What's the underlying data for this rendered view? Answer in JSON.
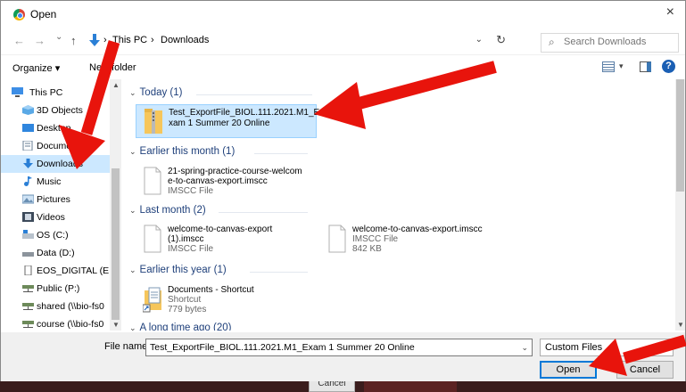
{
  "window": {
    "title": "Open",
    "close_glyph": "×"
  },
  "nav_buttons": {
    "back": "←",
    "forward": "→",
    "recent": "⌄",
    "up": "↑"
  },
  "address": {
    "crumbs": [
      "This PC",
      "Downloads"
    ],
    "separator": "›",
    "dropdown_glyph": "⌄",
    "refresh_glyph": "↻"
  },
  "search": {
    "placeholder": "Search Downloads",
    "icon": "search-icon"
  },
  "toolbar": {
    "organize": "Organize ▾",
    "new_folder": "New folder",
    "view_dropdown": "▾",
    "help": "?"
  },
  "nav_pane": {
    "items": [
      {
        "label": "This PC",
        "icon": "computer-icon"
      },
      {
        "label": "3D Objects",
        "icon": "cube-icon"
      },
      {
        "label": "Desktop",
        "icon": "desktop-icon"
      },
      {
        "label": "Documents",
        "icon": "document-icon"
      },
      {
        "label": "Downloads",
        "icon": "download-icon",
        "selected": true
      },
      {
        "label": "Music",
        "icon": "music-icon"
      },
      {
        "label": "Pictures",
        "icon": "pictures-icon"
      },
      {
        "label": "Videos",
        "icon": "video-icon"
      },
      {
        "label": "OS (C:)",
        "icon": "drive-icon"
      },
      {
        "label": "Data (D:)",
        "icon": "drive-icon"
      },
      {
        "label": "EOS_DIGITAL (E:)",
        "icon": "sd-card-icon"
      },
      {
        "label": "Public (P:)",
        "icon": "network-drive-icon"
      },
      {
        "label": "shared (\\\\bio-fs0",
        "icon": "network-drive-icon"
      },
      {
        "label": "course (\\\\bio-fs0",
        "icon": "network-drive-icon"
      }
    ]
  },
  "groups": [
    {
      "label": "Today (1)"
    },
    {
      "label": "Earlier this month (1)"
    },
    {
      "label": "Last month (2)"
    },
    {
      "label": "Earlier this year (1)"
    },
    {
      "label": "A long time ago (20)"
    }
  ],
  "files": {
    "today": {
      "name_line1": "Test_ExportFile_BIOL.111.2021.M1_E",
      "name_line2": "xam 1 Summer 20 Online",
      "icon": "zip-folder-icon"
    },
    "month": {
      "name_line1": "21-spring-practice-course-welcom",
      "name_line2": "e-to-canvas-export.imscc",
      "type": "IMSCC File"
    },
    "last1": {
      "name_line1": "welcome-to-canvas-export",
      "name_line2": "(1).imscc",
      "type": "IMSCC File"
    },
    "last2": {
      "name_line1": "welcome-to-canvas-export.imscc",
      "type": "IMSCC File",
      "size": "842 KB"
    },
    "year": {
      "name_line1": "Documents - Shortcut",
      "type": "Shortcut",
      "size": "779 bytes"
    }
  },
  "bottom": {
    "file_name_label": "File name:",
    "file_name_value": "Test_ExportFile_BIOL.111.2021.M1_Exam 1 Summer 20 Online",
    "file_type": "Custom Files",
    "open_label": "Open",
    "cancel_label": "Cancel"
  },
  "background": {
    "cancel_label": "Cancel"
  },
  "colors": {
    "selection": "#cce8ff",
    "accent": "#0078d7",
    "arrow": "#e8140c"
  }
}
